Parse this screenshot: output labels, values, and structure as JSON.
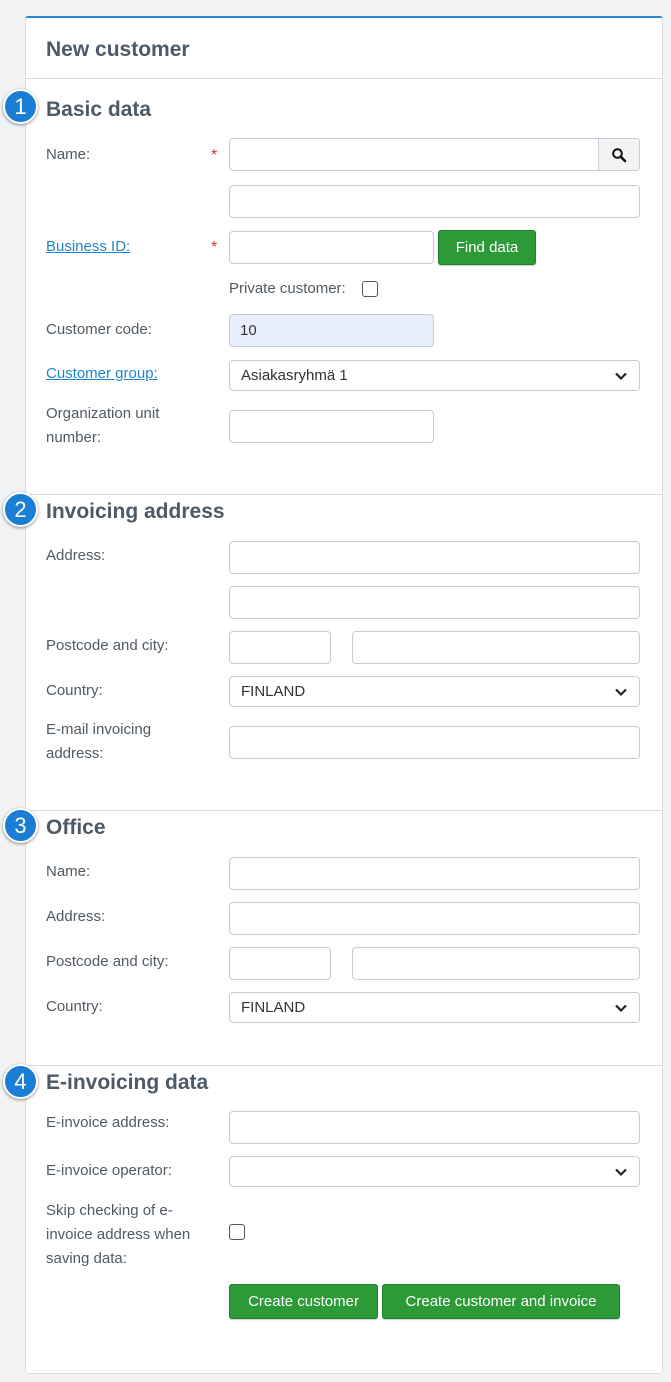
{
  "form": {
    "title": "New customer",
    "sections": {
      "basic": {
        "number": "1",
        "title": "Basic data"
      },
      "invoicing": {
        "number": "2",
        "title": "Invoicing address"
      },
      "office": {
        "number": "3",
        "title": "Office"
      },
      "einvoicing": {
        "number": "4",
        "title": "E-invoicing data"
      }
    }
  },
  "basic": {
    "name_label": "Name:",
    "required_mark": "*",
    "name_value": "",
    "name2_value": "",
    "business_id_label": "Business ID:",
    "business_id_value": "",
    "find_data_button": "Find data",
    "private_customer_label": "Private customer:",
    "private_customer_checked": false,
    "customer_code_label": "Customer code:",
    "customer_code_value": "10",
    "customer_group_label": "Customer group:",
    "customer_group_value": "Asiakasryhmä 1",
    "org_unit_label_1": "Organization unit",
    "org_unit_label_2": "number:",
    "org_unit_value": ""
  },
  "invoicing": {
    "address_label": "Address:",
    "postcode_city_label": "Postcode and city:",
    "country_label": "Country:",
    "country_value": "FINLAND",
    "email_label_1": "E-mail invoicing",
    "email_label_2": "address:"
  },
  "office": {
    "name_label": "Name:",
    "address_label": "Address:",
    "postcode_city_label": "Postcode and city:",
    "country_label": "Country:",
    "country_value": "FINLAND"
  },
  "einvoicing": {
    "address_label": "E-invoice address:",
    "operator_label": "E-invoice operator:",
    "operator_value": "",
    "skip_label_1": "Skip checking of e-",
    "skip_label_2": "invoice address when",
    "skip_label_3": "saving data:",
    "skip_checked": false
  },
  "actions": {
    "create_customer": "Create customer",
    "create_customer_and_invoice": "Create customer and invoice"
  },
  "colors": {
    "accent": "#1a7fd4",
    "button_green": "#2c9a37",
    "link": "#1f87c9",
    "required": "#d9342b"
  },
  "icons": {
    "search": "search-icon",
    "chevron": "chevron-down-icon"
  }
}
